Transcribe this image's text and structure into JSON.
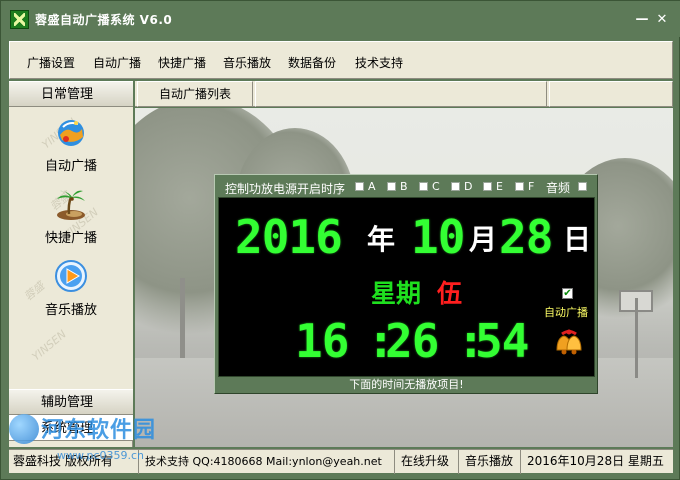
{
  "window": {
    "title": "蓉盛自动广播系统 V6.0",
    "minimize_glyph": "—",
    "close_glyph": "✕"
  },
  "menu": {
    "items": [
      "广播设置",
      "自动广播",
      "快捷广播",
      "音乐播放",
      "数据备份",
      "技术支持"
    ]
  },
  "sidebar": {
    "daily_header": "日常管理",
    "items": [
      {
        "label": "自动广播",
        "icon": "globe-broadcast-icon"
      },
      {
        "label": "快捷广播",
        "icon": "palm-island-icon"
      },
      {
        "label": "音乐播放",
        "icon": "play-icon"
      }
    ],
    "watermarks": [
      "YINSEN",
      "蓉盛",
      "YINSEN",
      "蓉盛",
      "YINSEN"
    ],
    "aux_header": "辅助管理",
    "sys_header": "系统管理"
  },
  "tabs": {
    "active": "自动广播列表"
  },
  "clock_panel": {
    "power_label": "控制功放电源开启时序",
    "channels": [
      "A",
      "B",
      "C",
      "D",
      "E",
      "F"
    ],
    "audio_label": "音频",
    "date": {
      "year": "2016",
      "year_unit": "年",
      "month": "10",
      "month_unit": "月",
      "day": "28",
      "day_unit": "日"
    },
    "weekday_prefix": "星期",
    "weekday": "伍",
    "auto_broadcast_checked": true,
    "auto_broadcast_check_glyph": "✔",
    "auto_broadcast_label": "自动广播",
    "time": {
      "hours": "16",
      "colon": ":",
      "minutes": "26",
      "seconds": "54"
    },
    "status": "下面的时间无播放项目!",
    "colors": {
      "digit": "#33ff33",
      "weekday_prefix": "#1fe01f",
      "weekday_value": "#ff1f1f",
      "auto_label": "#ffff66",
      "frame": "#5d7a58"
    }
  },
  "statusbar": {
    "copyright": "蓉盛科技 版权所有",
    "contact": "技术支持 QQ:4180668 Mail:ynlon@yeah.net",
    "upgrade": "在线升级",
    "music": "音乐播放",
    "date": "2016年10月28日 星期五"
  },
  "watermark": {
    "site": "河东软件园",
    "url": "www.pc0359.cn"
  }
}
